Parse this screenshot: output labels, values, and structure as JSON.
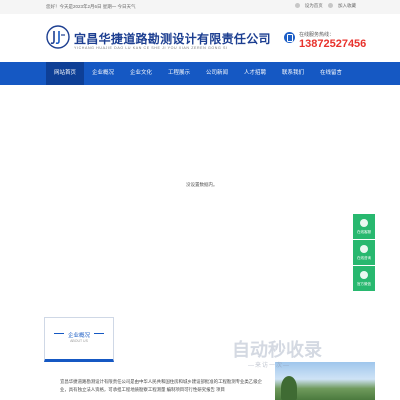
{
  "topbar": {
    "welcome": "您好！今天是2023年2月6日 星期一 今日天气",
    "set_home": "设为首页",
    "add_fav": "加入收藏"
  },
  "header": {
    "company_name": "宜昌华捷道路勘测设计有限责任公司",
    "company_pinyin": "YICHANG HUAJIE DAO LU KAN CE SHE JI YOU XIAN ZEREN GONG SI",
    "hotline_label": "在线服务热线：",
    "hotline_number": "13872527456"
  },
  "nav": {
    "items": [
      {
        "label": "网站首页",
        "active": true
      },
      {
        "label": "企业概况",
        "active": false
      },
      {
        "label": "企业文化",
        "active": false
      },
      {
        "label": "工程展示",
        "active": false
      },
      {
        "label": "公司新闻",
        "active": false
      },
      {
        "label": "人才招聘",
        "active": false
      },
      {
        "label": "联系我们",
        "active": false
      },
      {
        "label": "在线留言",
        "active": false
      }
    ]
  },
  "banner": {
    "message": "没设置数据内。"
  },
  "sidebar": {
    "items": [
      {
        "label": "在线客服",
        "icon": "chat-icon"
      },
      {
        "label": "在线咨询",
        "icon": "headset-icon"
      },
      {
        "label": "官方微信",
        "icon": "wechat-icon"
      }
    ]
  },
  "about": {
    "title": "企业概况",
    "subtitle": "ABOUT US",
    "text": "宜昌华捷道路勘测设计有限责任公司是由中华人民共和国住房和城乡建设部批准的工程勘测专业类乙级企业，具有独立法人资格，可承担工程地质勘察工程测量 编制项目可行性研究报告 项目"
  },
  "watermark": {
    "main": "自动秒收录",
    "sub": "—来访一次—"
  },
  "colors": {
    "brand_blue": "#1558c3",
    "nav_active": "#0e3f96",
    "hotline_red": "#e8322c",
    "sidebar_green": "#28b86f"
  }
}
